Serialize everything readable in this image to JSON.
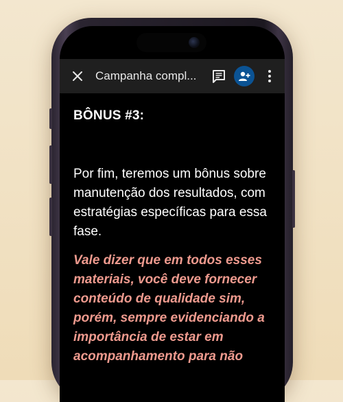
{
  "appbar": {
    "title": "Campanha compl...",
    "icons": {
      "close": "close-icon",
      "comment": "comment-icon",
      "share": "person-add-icon",
      "more": "more-vertical-icon"
    },
    "share_button_color": "#0b5394"
  },
  "document": {
    "heading": "BÔNUS #3:",
    "paragraph": "Por fim, teremos um bônus sobre manutenção dos resultados, com estratégias específicas para essa fase.",
    "emphasis": "Vale dizer que em todos esses materiais, você deve fornecer conteúdo de qualidade sim, porém, sempre evidenciando a importância de estar em acompanhamento para não",
    "emphasis_color": "#ee9a8e"
  }
}
